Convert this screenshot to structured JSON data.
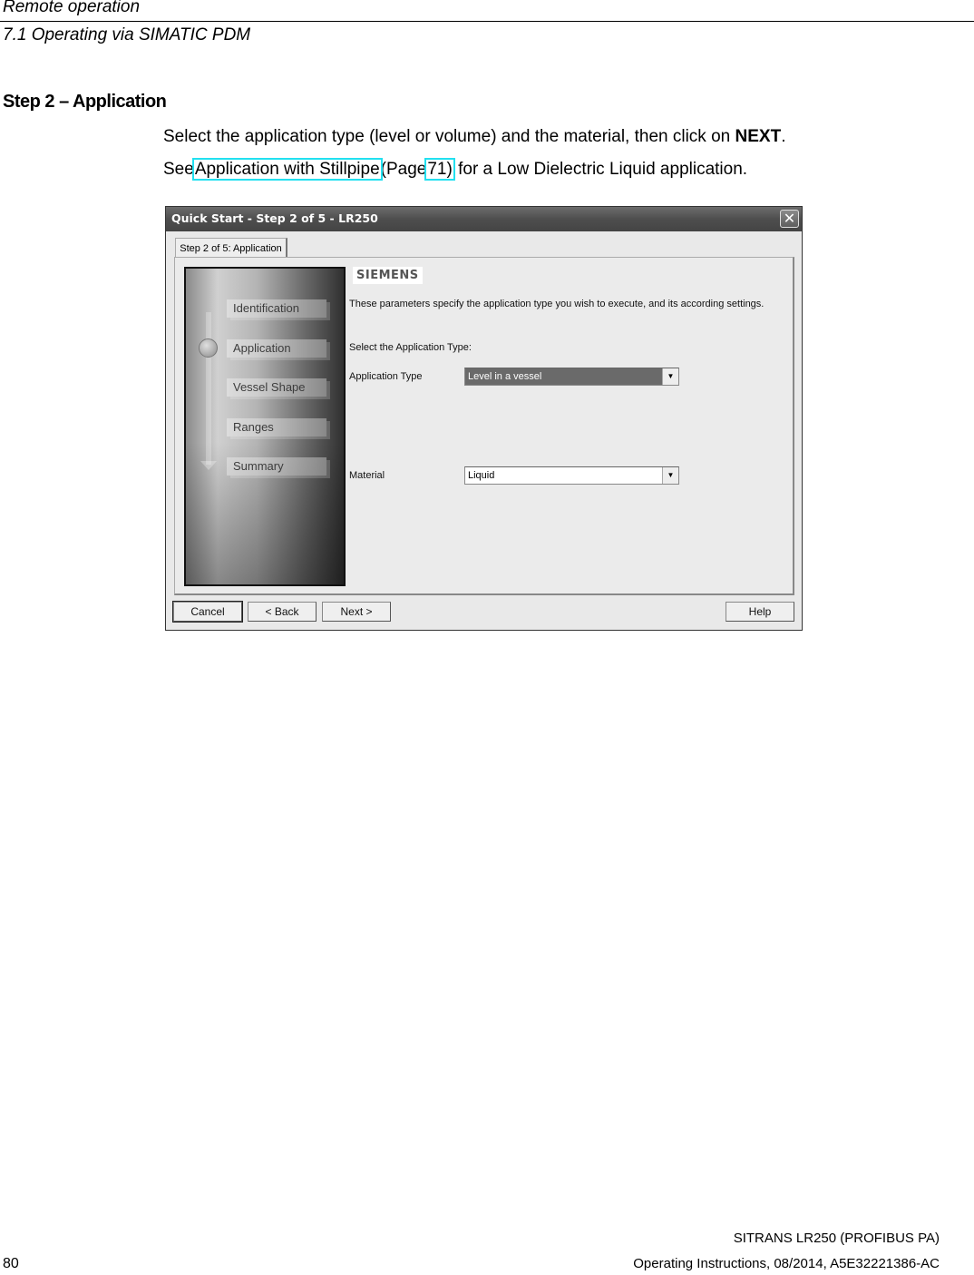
{
  "header": {
    "chapter": "Remote operation",
    "section": "7.1 Operating via SIMATIC PDM"
  },
  "step": {
    "title": "Step 2 – Application",
    "para1_text": "Select the application type (level or volume) and the material, then click on ",
    "para1_bold": "NEXT",
    "para1_end": ".",
    "para2_see": "See",
    "para2_link": "Application with Stillpipe",
    "para2_page_pre": "(Page",
    "para2_page_link": "71)",
    "para2_rest": " for a Low Dielectric Liquid application."
  },
  "dialog": {
    "title": "Quick Start - Step 2 of 5 - LR250",
    "close_icon": "close-icon",
    "tab_label": "Step 2 of 5: Application",
    "nav_items": [
      "Identification",
      "Application",
      "Vessel Shape",
      "Ranges",
      "Summary"
    ],
    "current_step": "Application",
    "brand": "SIEMENS",
    "description": "These parameters specify the application type you wish to execute, and its according settings.",
    "select_prompt": "Select the Application Type:",
    "fields": [
      {
        "label": "Application Type",
        "value": "Level in a vessel"
      },
      {
        "label": "Material",
        "value": "Liquid"
      }
    ],
    "buttons": {
      "cancel": "Cancel",
      "back": "< Back",
      "next": "Next >",
      "help": "Help"
    }
  },
  "footer": {
    "product": "SITRANS LR250 (PROFIBUS PA)",
    "page_number": "80",
    "doc_info": "Operating Instructions, 08/2014, A5E32221386-AC"
  },
  "colors": {
    "link_outline": "#22e0f0",
    "titlebar": "#555555",
    "dialog_bg": "#e9e9e9"
  }
}
